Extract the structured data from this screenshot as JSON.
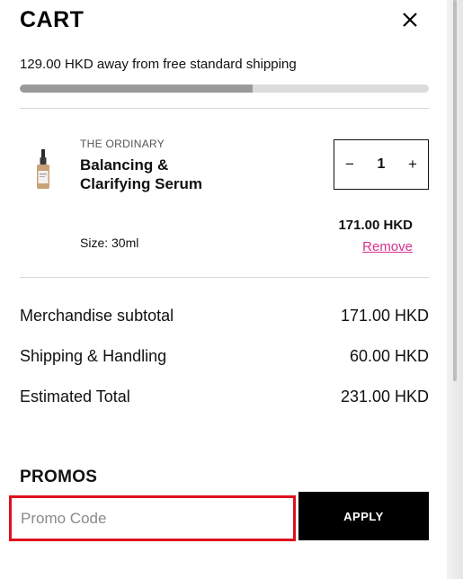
{
  "header": {
    "title": "CART",
    "close_icon": "close-icon"
  },
  "shipping": {
    "message": "129.00 HKD away from free standard shipping",
    "progress_fraction": 0.57
  },
  "item": {
    "brand": "THE ORDINARY",
    "name": "Balancing & Clarifying Serum",
    "size": "Size: 30ml",
    "quantity": "1",
    "decrement_label": "−",
    "increment_label": "+",
    "price": "171.00 HKD",
    "remove_label": "Remove",
    "image_icon": "serum-bottle-icon"
  },
  "summary": {
    "rows": [
      {
        "label": "Merchandise subtotal",
        "value": "171.00 HKD"
      },
      {
        "label": "Shipping & Handling",
        "value": "60.00 HKD"
      },
      {
        "label": "Estimated Total",
        "value": "231.00 HKD"
      }
    ]
  },
  "promos": {
    "title": "PROMOS",
    "placeholder": "Promo Code",
    "value": "",
    "apply_label": "APPLY"
  },
  "colors": {
    "accent_link": "#d6318e",
    "highlight_border": "#e0101d",
    "button_bg": "#000000",
    "progress_fill": "#9a9a9a",
    "progress_track": "#dcdcdc"
  }
}
